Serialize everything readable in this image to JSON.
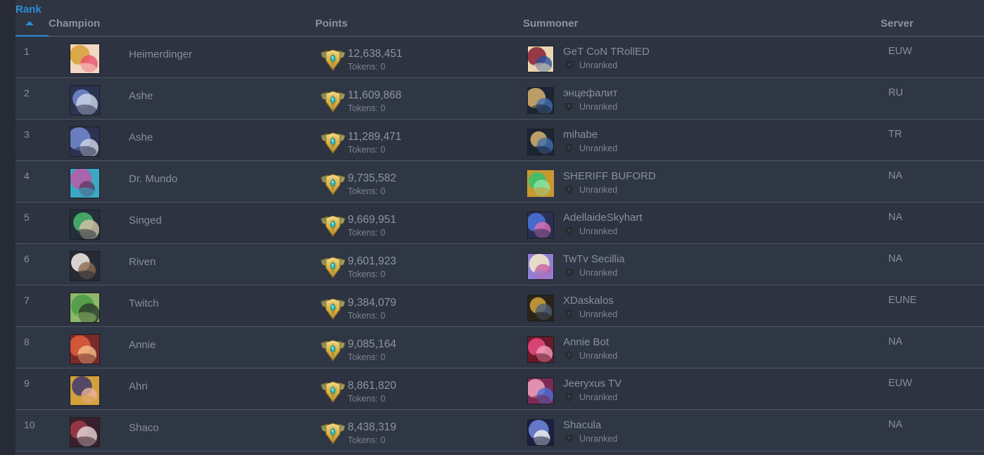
{
  "table": {
    "columns": [
      {
        "key": "rank",
        "label": "Rank",
        "sorted": true,
        "sort_direction": "asc"
      },
      {
        "key": "champion",
        "label": "Champion",
        "sorted": false
      },
      {
        "key": "points",
        "label": "Points",
        "sorted": false
      },
      {
        "key": "summoner",
        "label": "Summoner",
        "sorted": false
      },
      {
        "key": "server",
        "label": "Server",
        "sorted": false
      }
    ],
    "icons": {
      "sort_arrow": "caret-up-icon",
      "mastery_badge": "mastery-crest-icon",
      "unranked": "unranked-wing-icon"
    },
    "colors": {
      "accent": "#2a8fd4",
      "page_background": "#262b36",
      "table_background": "#2f3542",
      "row_border": "#4e5663",
      "text": "#878f9d",
      "header_text": "#8b93a1",
      "mastery_gold": "#d4af37",
      "mastery_gem": "#36c6c6"
    },
    "rows": [
      {
        "rank": "1",
        "champion": "Heimerdinger",
        "champion_colors": [
          "#d9a441",
          "#e8516b",
          "#f2d9c6"
        ],
        "points": "12,638,451",
        "tokens": "Tokens: 0",
        "summoner": "GeT CoN TRollED",
        "summoner_rank": "Unranked",
        "summoner_colors": [
          "#8e2b3c",
          "#2b4f9e",
          "#e8d6b0"
        ],
        "summoner_border": "plain",
        "server": "EUW"
      },
      {
        "rank": "2",
        "champion": "Ashe",
        "champion_colors": [
          "#6f84c8",
          "#cfd8ea",
          "#2b3350"
        ],
        "points": "11,609,868",
        "tokens": "Tokens: 0",
        "summoner": "энцефалит",
        "summoner_rank": "Unranked",
        "summoner_colors": [
          "#c9a86a",
          "#3f6fae",
          "#1d2433"
        ],
        "summoner_border": "plain",
        "server": "RU"
      },
      {
        "rank": "3",
        "champion": "Ashe",
        "champion_colors": [
          "#6f84c8",
          "#cfd8ea",
          "#2b3350"
        ],
        "points": "11,289,471",
        "tokens": "Tokens: 0",
        "summoner": "mihabe",
        "summoner_rank": "Unranked",
        "summoner_colors": [
          "#c9a86a",
          "#3f6fae",
          "#1d2433"
        ],
        "summoner_border": "plain",
        "server": "TR"
      },
      {
        "rank": "4",
        "champion": "Dr. Mundo",
        "champion_colors": [
          "#b15fa8",
          "#5f3b63",
          "#3ba9c4"
        ],
        "points": "9,735,582",
        "tokens": "Tokens: 0",
        "summoner": "SHERIFF BUFORD",
        "summoner_rank": "Unranked",
        "summoner_colors": [
          "#3fbf6f",
          "#8fe3a8",
          "#c8982f"
        ],
        "summoner_border": "gold",
        "server": "NA"
      },
      {
        "rank": "5",
        "champion": "Singed",
        "champion_colors": [
          "#46b06a",
          "#d8c4a8",
          "#23303a"
        ],
        "points": "9,669,951",
        "tokens": "Tokens: 0",
        "summoner": "AdellaideSkyhart",
        "summoner_rank": "Unranked",
        "summoner_colors": [
          "#4a6fd4",
          "#e06fb0",
          "#2a2f55"
        ],
        "summoner_border": "plain",
        "server": "NA"
      },
      {
        "rank": "6",
        "champion": "Riven",
        "champion_colors": [
          "#e7e2dc",
          "#8c6b52",
          "#262a33"
        ],
        "points": "9,601,923",
        "tokens": "Tokens: 0",
        "summoner": "TwTv Secillia",
        "summoner_rank": "Unranked",
        "summoner_colors": [
          "#efe3c8",
          "#c85fa8",
          "#8f7fd4"
        ],
        "summoner_border": "plain",
        "server": "NA"
      },
      {
        "rank": "7",
        "champion": "Twitch",
        "champion_colors": [
          "#4f9b4a",
          "#2a3b2a",
          "#8fb86a"
        ],
        "points": "9,384,079",
        "tokens": "Tokens: 0",
        "summoner": "XDaskalos",
        "summoner_rank": "Unranked",
        "summoner_colors": [
          "#c89a3c",
          "#4f5f7a",
          "#2a2418"
        ],
        "summoner_border": "plain",
        "server": "EUNE"
      },
      {
        "rank": "8",
        "champion": "Annie",
        "champion_colors": [
          "#d85a3c",
          "#f2c28a",
          "#7a2a28"
        ],
        "points": "9,085,164",
        "tokens": "Tokens: 0",
        "summoner": "Annie Bot",
        "summoner_rank": "Unranked",
        "summoner_colors": [
          "#e0487a",
          "#f2a0c0",
          "#6a1a2a"
        ],
        "summoner_border": "plain",
        "server": "NA"
      },
      {
        "rank": "9",
        "champion": "Ahri",
        "champion_colors": [
          "#4a3f6a",
          "#e8b0a0",
          "#d4a03c"
        ],
        "points": "8,861,820",
        "tokens": "Tokens: 0",
        "summoner": "Jeeryxus TV",
        "summoner_rank": "Unranked",
        "summoner_colors": [
          "#e89ab8",
          "#4a6fd4",
          "#7a2a55"
        ],
        "summoner_border": "plain",
        "server": "EUW"
      },
      {
        "rank": "10",
        "champion": "Shaco",
        "champion_colors": [
          "#9b3a4a",
          "#e8d8d8",
          "#3a1f2a"
        ],
        "points": "8,438,319",
        "tokens": "Tokens: 0",
        "summoner": "Shacula",
        "summoner_rank": "Unranked",
        "summoner_colors": [
          "#6a7fd4",
          "#f2f2f2",
          "#1a2040"
        ],
        "summoner_border": "plain",
        "server": "NA"
      }
    ]
  }
}
